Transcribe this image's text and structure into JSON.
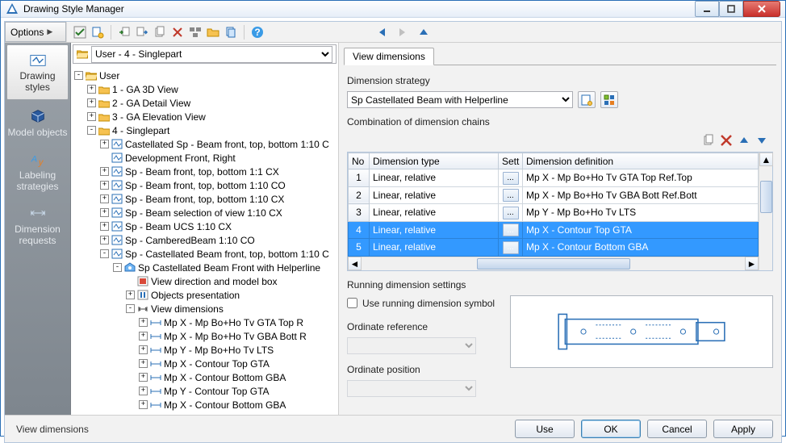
{
  "window": {
    "title": "Drawing Style Manager"
  },
  "options_label": "Options",
  "sidebar": {
    "items": [
      {
        "label": "Drawing styles"
      },
      {
        "label": "Model objects"
      },
      {
        "label": "Labeling strategies"
      },
      {
        "label": "Dimension requests"
      }
    ]
  },
  "path_bar": {
    "value": "User - 4 - Singlepart"
  },
  "tree": {
    "nodes": [
      {
        "depth": 0,
        "tw": "-",
        "icon": "folder-open",
        "label": "User"
      },
      {
        "depth": 1,
        "tw": "+",
        "icon": "folder",
        "label": "1 - GA 3D View"
      },
      {
        "depth": 1,
        "tw": "+",
        "icon": "folder",
        "label": "2 - GA Detail View"
      },
      {
        "depth": 1,
        "tw": "+",
        "icon": "folder",
        "label": "3 - GA Elevation View"
      },
      {
        "depth": 1,
        "tw": "-",
        "icon": "folder",
        "label": "4 - Singlepart"
      },
      {
        "depth": 2,
        "tw": "+",
        "icon": "style",
        "label": "Castellated Sp - Beam front, top, bottom 1:10 C"
      },
      {
        "depth": 2,
        "tw": "",
        "icon": "style",
        "label": "Development Front, Right"
      },
      {
        "depth": 2,
        "tw": "+",
        "icon": "style",
        "label": "Sp - Beam front, top, bottom 1:1 CX"
      },
      {
        "depth": 2,
        "tw": "+",
        "icon": "style",
        "label": "Sp - Beam front, top, bottom 1:10 CO"
      },
      {
        "depth": 2,
        "tw": "+",
        "icon": "style",
        "label": "Sp - Beam front, top, bottom 1:10 CX"
      },
      {
        "depth": 2,
        "tw": "+",
        "icon": "style",
        "label": "Sp - Beam selection of view 1:10 CX"
      },
      {
        "depth": 2,
        "tw": "+",
        "icon": "style",
        "label": "Sp - Beam UCS 1:10 CX"
      },
      {
        "depth": 2,
        "tw": "+",
        "icon": "style",
        "label": "Sp - CamberedBeam 1:10 CO"
      },
      {
        "depth": 2,
        "tw": "-",
        "icon": "style",
        "label": "Sp - Castellated Beam front, top, bottom 1:10 C"
      },
      {
        "depth": 3,
        "tw": "-",
        "icon": "view",
        "label": "Sp Castellated Beam Front with Helperline"
      },
      {
        "depth": 4,
        "tw": "",
        "icon": "leaf-red",
        "label": "View direction and model box"
      },
      {
        "depth": 4,
        "tw": "+",
        "icon": "leaf-blue",
        "label": "Objects presentation"
      },
      {
        "depth": 4,
        "tw": "-",
        "icon": "leaf-dim",
        "label": "View dimensions"
      },
      {
        "depth": 5,
        "tw": "+",
        "icon": "dim",
        "label": "Mp X - Mp Bo+Ho Tv GTA Top R"
      },
      {
        "depth": 5,
        "tw": "+",
        "icon": "dim",
        "label": "Mp X - Mp Bo+Ho Tv GBA Bott R"
      },
      {
        "depth": 5,
        "tw": "+",
        "icon": "dim",
        "label": "Mp Y - Mp Bo+Ho Tv LTS"
      },
      {
        "depth": 5,
        "tw": "+",
        "icon": "dim",
        "label": "Mp X - Contour Top GTA"
      },
      {
        "depth": 5,
        "tw": "+",
        "icon": "dim",
        "label": "Mp X - Contour Bottom GBA"
      },
      {
        "depth": 5,
        "tw": "+",
        "icon": "dim",
        "label": "Mp Y - Contour Top GTA"
      },
      {
        "depth": 5,
        "tw": "+",
        "icon": "dim",
        "label": "Mp X - Contour Bottom GBA"
      }
    ]
  },
  "right": {
    "tab": "View dimensions",
    "strategy_label": "Dimension strategy",
    "strategy_value": "Sp Castellated Beam with Helperline",
    "combo_label": "Combination of dimension chains",
    "columns": {
      "no": "No",
      "type": "Dimension type",
      "set": "Sett",
      "def": "Dimension definition"
    },
    "rows": [
      {
        "no": "1",
        "type": "Linear, relative",
        "def": "Mp X - Mp Bo+Ho Tv GTA Top Ref.Top",
        "sel": false
      },
      {
        "no": "2",
        "type": "Linear, relative",
        "def": "Mp X - Mp Bo+Ho Tv GBA Bott Ref.Bott",
        "sel": false
      },
      {
        "no": "3",
        "type": "Linear, relative",
        "def": "Mp Y - Mp Bo+Ho Tv LTS",
        "sel": false
      },
      {
        "no": "4",
        "type": "Linear, relative",
        "def": "Mp X - Contour Top GTA",
        "sel": true
      },
      {
        "no": "5",
        "type": "Linear, relative",
        "def": "Mp X - Contour Bottom GBA",
        "sel": true
      }
    ],
    "running_label": "Running dimension settings",
    "use_running_label": "Use running dimension symbol",
    "use_running_checked": false,
    "ordinate_ref_label": "Ordinate reference",
    "ordinate_pos_label": "Ordinate position"
  },
  "buttons": {
    "use": "Use",
    "ok": "OK",
    "cancel": "Cancel",
    "apply": "Apply"
  },
  "status": "View dimensions",
  "colors": {
    "accent": "#3399ff",
    "win_border": "#2a6fb6"
  }
}
